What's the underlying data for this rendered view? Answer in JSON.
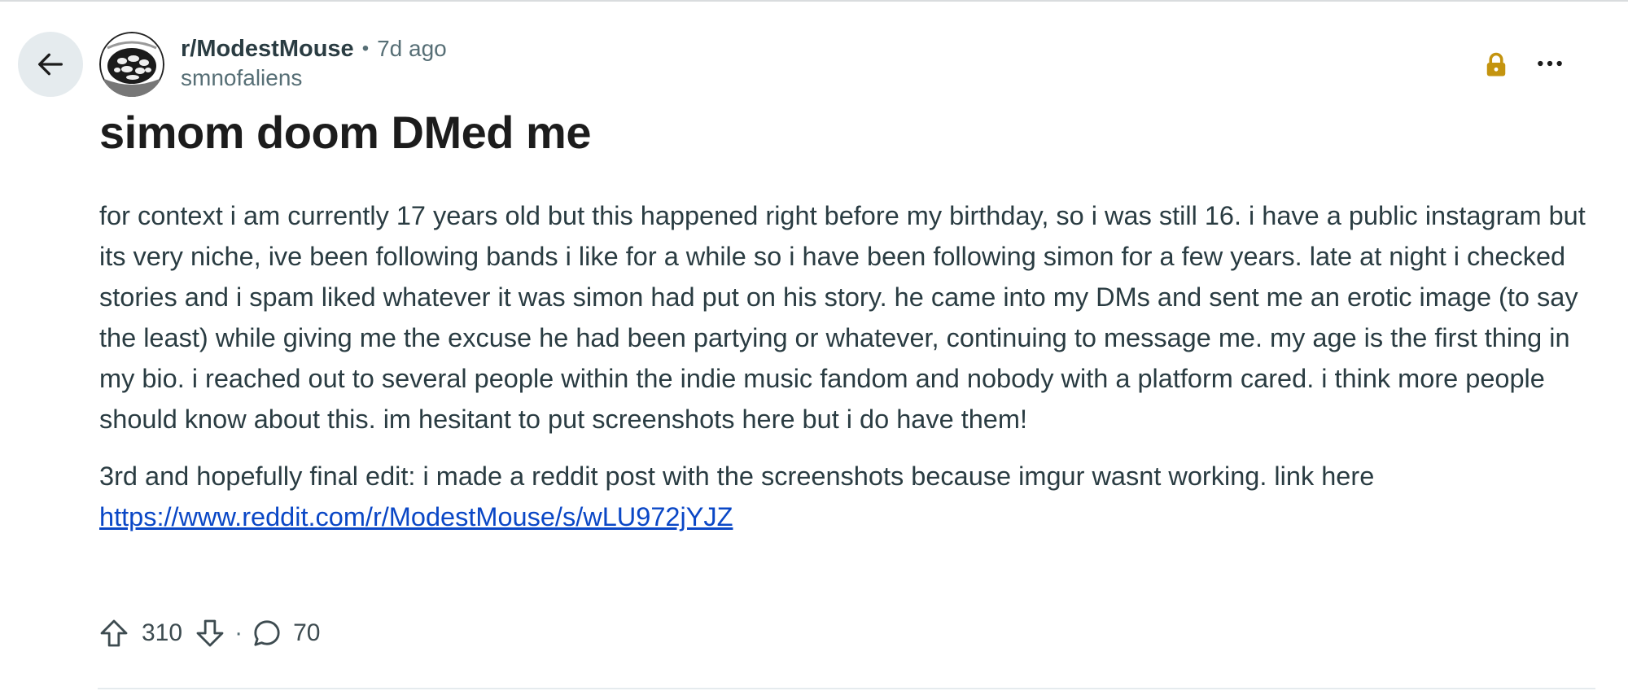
{
  "post": {
    "subreddit": "r/ModestMouse",
    "separator": "•",
    "time_ago": "7d ago",
    "author": "smnofaliens",
    "title": "simom doom DMed me",
    "body": [
      "for context i am currently 17 years old but this happened right before my birthday, so i was still 16. i have a public instagram but its very niche, ive been following bands i like for a while so i have been following simon for a few years. late at night i checked stories and i spam liked whatever it was simon had put on his story. he came into my DMs and sent me an erotic image (to say the least) while giving me the excuse he had been partying or whatever, continuing to message me. my age is the first thing in my bio. i reached out to several people within the indie music fandom and nobody with a platform cared. i think more people should know about this. im hesitant to put screenshots here but i do have them!",
      "3rd and hopefully final edit: i made a reddit post with the screenshots because imgur wasnt working. link here"
    ],
    "link_url": "https://www.reddit.com/r/ModestMouse/s/wLU972jYJZ",
    "score": "310",
    "dot": "·",
    "comments": "70",
    "locked": true
  },
  "icons": {
    "back": "arrow-left-icon",
    "avatar": "subreddit-avatar",
    "lock": "lock-icon",
    "overflow": "more-horizontal-icon",
    "upvote": "arrow-up-icon",
    "downvote": "arrow-down-icon",
    "comment": "speech-bubble-icon"
  },
  "colors": {
    "lock": "#c4940f",
    "link": "#0a47c6",
    "meta": "#576f76"
  }
}
